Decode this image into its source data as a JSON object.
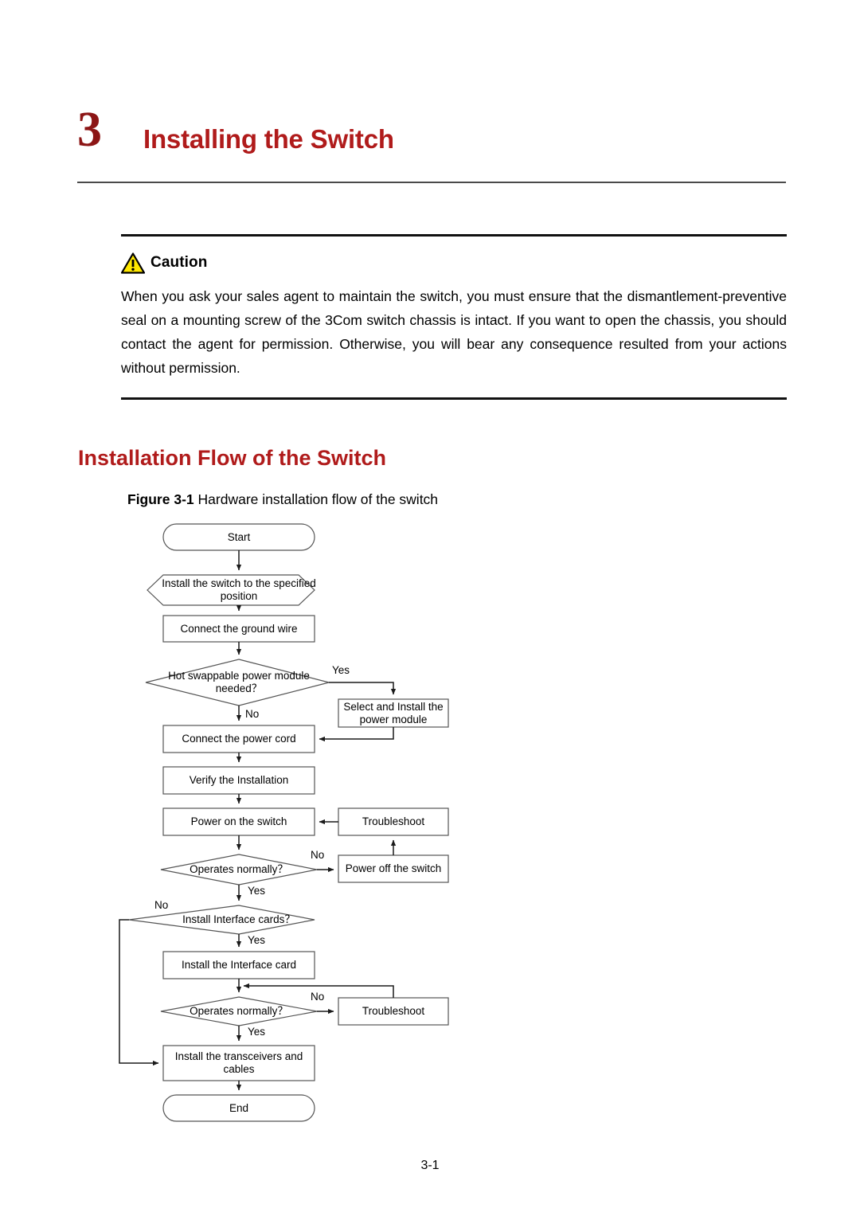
{
  "chapter": {
    "number": "3",
    "title": "Installing the Switch"
  },
  "caution": {
    "icon": "warning-triangle-icon",
    "label": "Caution",
    "body": "When you ask your sales agent to maintain the switch, you must ensure that the dismantlement-preventive seal on a mounting screw of the 3Com switch chassis is intact. If you want to open the chassis, you should contact the agent for permission. Otherwise, you will bear any consequence resulted from your actions without permission."
  },
  "section": {
    "heading": "Installation Flow of the Switch"
  },
  "figure": {
    "label": "Figure 3-1",
    "caption": "Hardware installation flow of the switch"
  },
  "flowchart": {
    "nodes": {
      "start": "Start",
      "install_position": "Install the switch to the specified position",
      "ground_wire": "Connect the ground wire",
      "hot_swappable": "Hot swappable power module needed？",
      "select_power_module": "Select and Install the power module",
      "power_cord": "Connect the power cord",
      "verify_installation": "Verify the Installation",
      "power_on": "Power on the switch",
      "troubleshoot_1": "Troubleshoot",
      "operates_normally_1": "Operates normally？",
      "power_off": "Power off the switch",
      "install_interface_cards_q": "Install Interface cards？",
      "install_interface_card": "Install the Interface card",
      "operates_normally_2": "Operates normally？",
      "troubleshoot_2": "Troubleshoot",
      "transceivers": "Install the transceivers and cables",
      "end": "End"
    },
    "edges": {
      "hot_swappable_yes": "Yes",
      "hot_swappable_no": "No",
      "operates_1_no": "No",
      "operates_1_yes": "Yes",
      "interface_cards_no": "No",
      "interface_cards_yes": "Yes",
      "operates_2_no": "No",
      "operates_2_yes": "Yes"
    }
  },
  "footer": {
    "page_number": "3-1"
  },
  "colors": {
    "heading_red": "#b01b1b",
    "chapter_number_red": "#8c1515",
    "caution_yellow": "#ffe800",
    "rule_dark": "#111111",
    "shape_stroke": "#555555"
  }
}
